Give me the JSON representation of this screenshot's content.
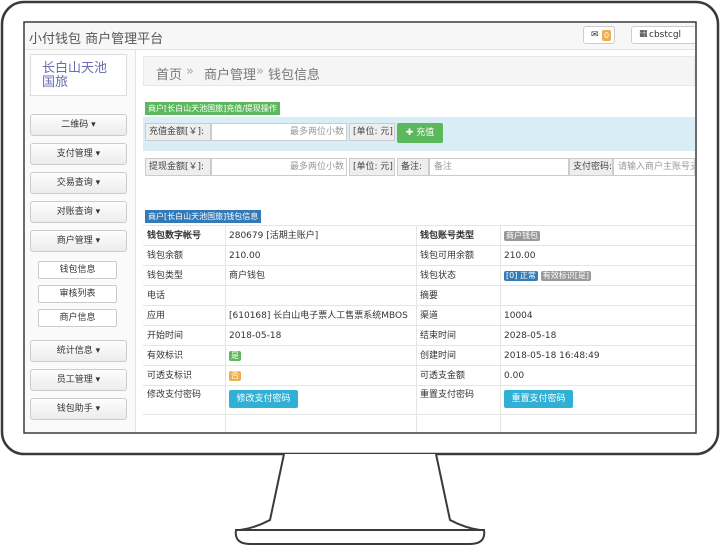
{
  "app": {
    "title": "小付钱包 商户管理平台"
  },
  "topbar": {
    "mail_count": "0",
    "user_label": "cbstcgl"
  },
  "sidebar": {
    "logo_text": "长白山天池国旅",
    "menu": [
      {
        "label": "二维码"
      },
      {
        "label": "支付管理"
      },
      {
        "label": "交易查询"
      },
      {
        "label": "对账查询"
      },
      {
        "label": "商户管理"
      }
    ],
    "submenu": [
      {
        "label": "钱包信息"
      },
      {
        "label": "审核列表"
      },
      {
        "label": "商户信息"
      }
    ],
    "menu2": [
      {
        "label": "统计信息"
      },
      {
        "label": "员工管理"
      },
      {
        "label": "钱包助手"
      }
    ]
  },
  "breadcrumb": {
    "home": "首页",
    "sep": "»",
    "section": "商户管理",
    "current": "钱包信息"
  },
  "ops": {
    "panel_title": "商户[长白山天池国旅]充值/提现操作",
    "recharge_label": "充值金额[￥]:",
    "recharge_placeholder": "最多两位小数",
    "unit": "[单位: 元]",
    "recharge_button": "充值",
    "withdraw_label": "提现金额[￥]:",
    "withdraw_placeholder": "最多两位小数",
    "remark_label": "备注:",
    "remark_placeholder": "备注",
    "paypwd_label": "支付密码:",
    "paypwd_placeholder": "请输入商户主账号支付密码"
  },
  "info": {
    "panel_title": "商户[长白山天池国旅]钱包信息",
    "rows": [
      {
        "k1": "钱包数字帐号",
        "v1": "280679 [活期主账户]",
        "k2": "钱包账号类型",
        "v2": "商户钱包"
      },
      {
        "k1": "钱包余额",
        "v1": "210.00",
        "k2": "钱包可用余额",
        "v2": "210.00"
      },
      {
        "k1": "钱包类型",
        "v1": "商户钱包",
        "k2": "钱包状态",
        "v2a": "[0] 正常",
        "v2b": "有效标识[是]"
      },
      {
        "k1": "电话",
        "v1": "",
        "k2": "摘要",
        "v2": ""
      },
      {
        "k1": "应用",
        "v1": "[610168] 长白山电子票人工售票系统MBOS",
        "k2": "渠道",
        "v2": "10004"
      },
      {
        "k1": "开始时间",
        "v1": "2018-05-18",
        "k2": "结束时间",
        "v2": "2028-05-18"
      },
      {
        "k1": "有效标识",
        "v1": "是",
        "k2": "创建时间",
        "v2": "2018-05-18 16:48:49"
      },
      {
        "k1": "可透支标识",
        "v1": "否",
        "k2": "可透支金额",
        "v2": "0.00"
      },
      {
        "k1": "修改支付密码",
        "v1": "修改支付密码",
        "k2": "重置支付密码",
        "v2": "重置支付密码"
      }
    ]
  },
  "colors": {
    "green": "#5cb85c",
    "blue": "#31b0d5",
    "orange": "#f0ad4e",
    "gray": "#999999",
    "darkblue": "#337ab7"
  }
}
